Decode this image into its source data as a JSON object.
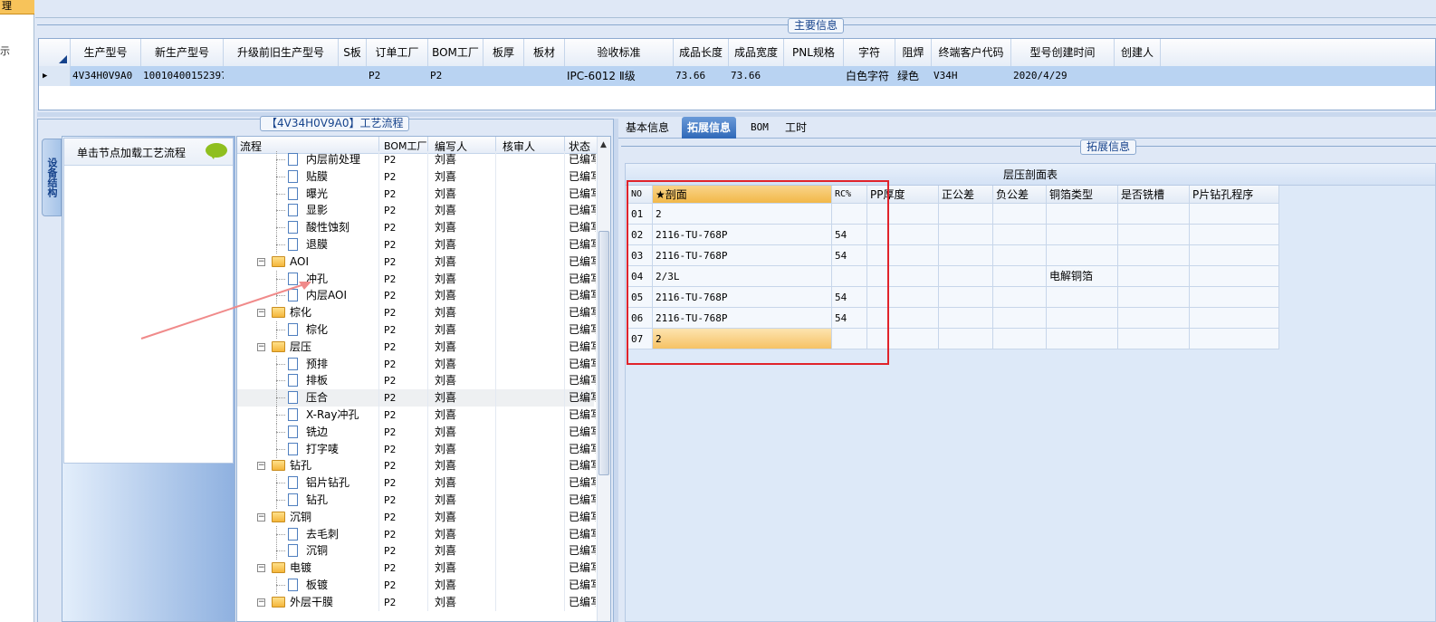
{
  "leftstrip": {
    "top_label": "理",
    "char": "示"
  },
  "main_info": {
    "title": "主要信息",
    "columns": [
      "生产型号",
      "新生产型号",
      "升级前旧生产型号",
      "S板",
      "订单工厂",
      "BOM工厂",
      "板厚",
      "板材",
      "验收标准",
      "成品长度",
      "成品宽度",
      "PNL规格",
      "字符",
      "阻焊",
      "终端客户代码",
      "型号创建时间",
      "创建人"
    ],
    "row": [
      "4V34H0V9A0",
      "10010400152397",
      "",
      "",
      "P2",
      "P2",
      "",
      "",
      "IPC-6012 Ⅱ级",
      "73.66",
      "73.66",
      "",
      "白色字符",
      "绿色",
      "V34H",
      "2020/4/29",
      ""
    ]
  },
  "flow_panel": {
    "title": "【4V34H0V9A0】工艺流程",
    "side_tab": "设备结构",
    "hint": "单击节点加载工艺流程",
    "columns": [
      "流程",
      "BOM工厂",
      "编写人",
      "核审人",
      "状态"
    ],
    "rows": [
      {
        "name": "内层前处理",
        "type": "doc",
        "bom": "P2",
        "writer": "刘喜",
        "reviewer": "",
        "status": "已编写"
      },
      {
        "name": "贴膜",
        "type": "doc",
        "bom": "P2",
        "writer": "刘喜",
        "reviewer": "",
        "status": "已编写"
      },
      {
        "name": "曝光",
        "type": "doc",
        "bom": "P2",
        "writer": "刘喜",
        "reviewer": "",
        "status": "已编写"
      },
      {
        "name": "显影",
        "type": "doc",
        "bom": "P2",
        "writer": "刘喜",
        "reviewer": "",
        "status": "已编写"
      },
      {
        "name": "酸性蚀刻",
        "type": "doc",
        "bom": "P2",
        "writer": "刘喜",
        "reviewer": "",
        "status": "已编写"
      },
      {
        "name": "退膜",
        "type": "doc",
        "bom": "P2",
        "writer": "刘喜",
        "reviewer": "",
        "status": "已编写"
      },
      {
        "name": "AOI",
        "type": "folder",
        "bom": "P2",
        "writer": "刘喜",
        "reviewer": "",
        "status": "已编写"
      },
      {
        "name": "冲孔",
        "type": "doc",
        "bom": "P2",
        "writer": "刘喜",
        "reviewer": "",
        "status": "已编写"
      },
      {
        "name": "内层AOI",
        "type": "doc",
        "bom": "P2",
        "writer": "刘喜",
        "reviewer": "",
        "status": "已编写"
      },
      {
        "name": "棕化",
        "type": "folder",
        "bom": "P2",
        "writer": "刘喜",
        "reviewer": "",
        "status": "已编写"
      },
      {
        "name": "棕化",
        "type": "doc",
        "bom": "P2",
        "writer": "刘喜",
        "reviewer": "",
        "status": "已编写"
      },
      {
        "name": "层压",
        "type": "folder",
        "bom": "P2",
        "writer": "刘喜",
        "reviewer": "",
        "status": "已编写"
      },
      {
        "name": "预排",
        "type": "doc",
        "bom": "P2",
        "writer": "刘喜",
        "reviewer": "",
        "status": "已编写"
      },
      {
        "name": "排板",
        "type": "doc",
        "bom": "P2",
        "writer": "刘喜",
        "reviewer": "",
        "status": "已编写"
      },
      {
        "name": "压合",
        "type": "doc",
        "bom": "P2",
        "writer": "刘喜",
        "reviewer": "",
        "status": "已编写"
      },
      {
        "name": "X-Ray冲孔",
        "type": "doc",
        "bom": "P2",
        "writer": "刘喜",
        "reviewer": "",
        "status": "已编写"
      },
      {
        "name": "铣边",
        "type": "doc",
        "bom": "P2",
        "writer": "刘喜",
        "reviewer": "",
        "status": "已编写"
      },
      {
        "name": "打字唛",
        "type": "doc",
        "bom": "P2",
        "writer": "刘喜",
        "reviewer": "",
        "status": "已编写"
      },
      {
        "name": "钻孔",
        "type": "folder",
        "bom": "P2",
        "writer": "刘喜",
        "reviewer": "",
        "status": "已编写"
      },
      {
        "name": "铝片钻孔",
        "type": "doc",
        "bom": "P2",
        "writer": "刘喜",
        "reviewer": "",
        "status": "已编写"
      },
      {
        "name": "钻孔",
        "type": "doc",
        "bom": "P2",
        "writer": "刘喜",
        "reviewer": "",
        "status": "已编写"
      },
      {
        "name": "沉铜",
        "type": "folder",
        "bom": "P2",
        "writer": "刘喜",
        "reviewer": "",
        "status": "已编写"
      },
      {
        "name": "去毛刺",
        "type": "doc",
        "bom": "P2",
        "writer": "刘喜",
        "reviewer": "",
        "status": "已编写"
      },
      {
        "name": "沉铜",
        "type": "doc",
        "bom": "P2",
        "writer": "刘喜",
        "reviewer": "",
        "status": "已编写"
      },
      {
        "name": "电镀",
        "type": "folder",
        "bom": "P2",
        "writer": "刘喜",
        "reviewer": "",
        "status": "已编写"
      },
      {
        "name": "板镀",
        "type": "doc",
        "bom": "P2",
        "writer": "刘喜",
        "reviewer": "",
        "status": "已编写"
      },
      {
        "name": "外层干膜",
        "type": "folder",
        "bom": "P2",
        "writer": "刘喜",
        "reviewer": "",
        "status": "已编写"
      }
    ]
  },
  "detail": {
    "tabs": [
      "基本信息",
      "拓展信息",
      "BOM",
      "工时"
    ],
    "active_tab": 1,
    "group_title": "拓展信息",
    "table_title": "层压剖面表",
    "columns": [
      "NO",
      "★剖面",
      "RC%",
      "PP厚度",
      "正公差",
      "负公差",
      "铜箔类型",
      "是否铣槽",
      "P片钻孔程序"
    ],
    "rows": [
      [
        "01",
        "2",
        "",
        "",
        "",
        "",
        "",
        "",
        ""
      ],
      [
        "02",
        "2116-TU-768P",
        "54",
        "",
        "",
        "",
        "",
        "",
        ""
      ],
      [
        "03",
        "2116-TU-768P",
        "54",
        "",
        "",
        "",
        "",
        "",
        ""
      ],
      [
        "04",
        "2/3L",
        "",
        "",
        "",
        "",
        "电解铜箔",
        "",
        ""
      ],
      [
        "05",
        "2116-TU-768P",
        "54",
        "",
        "",
        "",
        "",
        "",
        ""
      ],
      [
        "06",
        "2116-TU-768P",
        "54",
        "",
        "",
        "",
        "",
        "",
        ""
      ],
      [
        "07",
        "2",
        "",
        "",
        "",
        "",
        "",
        "",
        ""
      ]
    ]
  },
  "colors": {
    "highlight_box": "#e0232b",
    "arrow": "#f08a8a",
    "header_orange": "#f7c35a",
    "selected_row": "#b9d3f2"
  }
}
